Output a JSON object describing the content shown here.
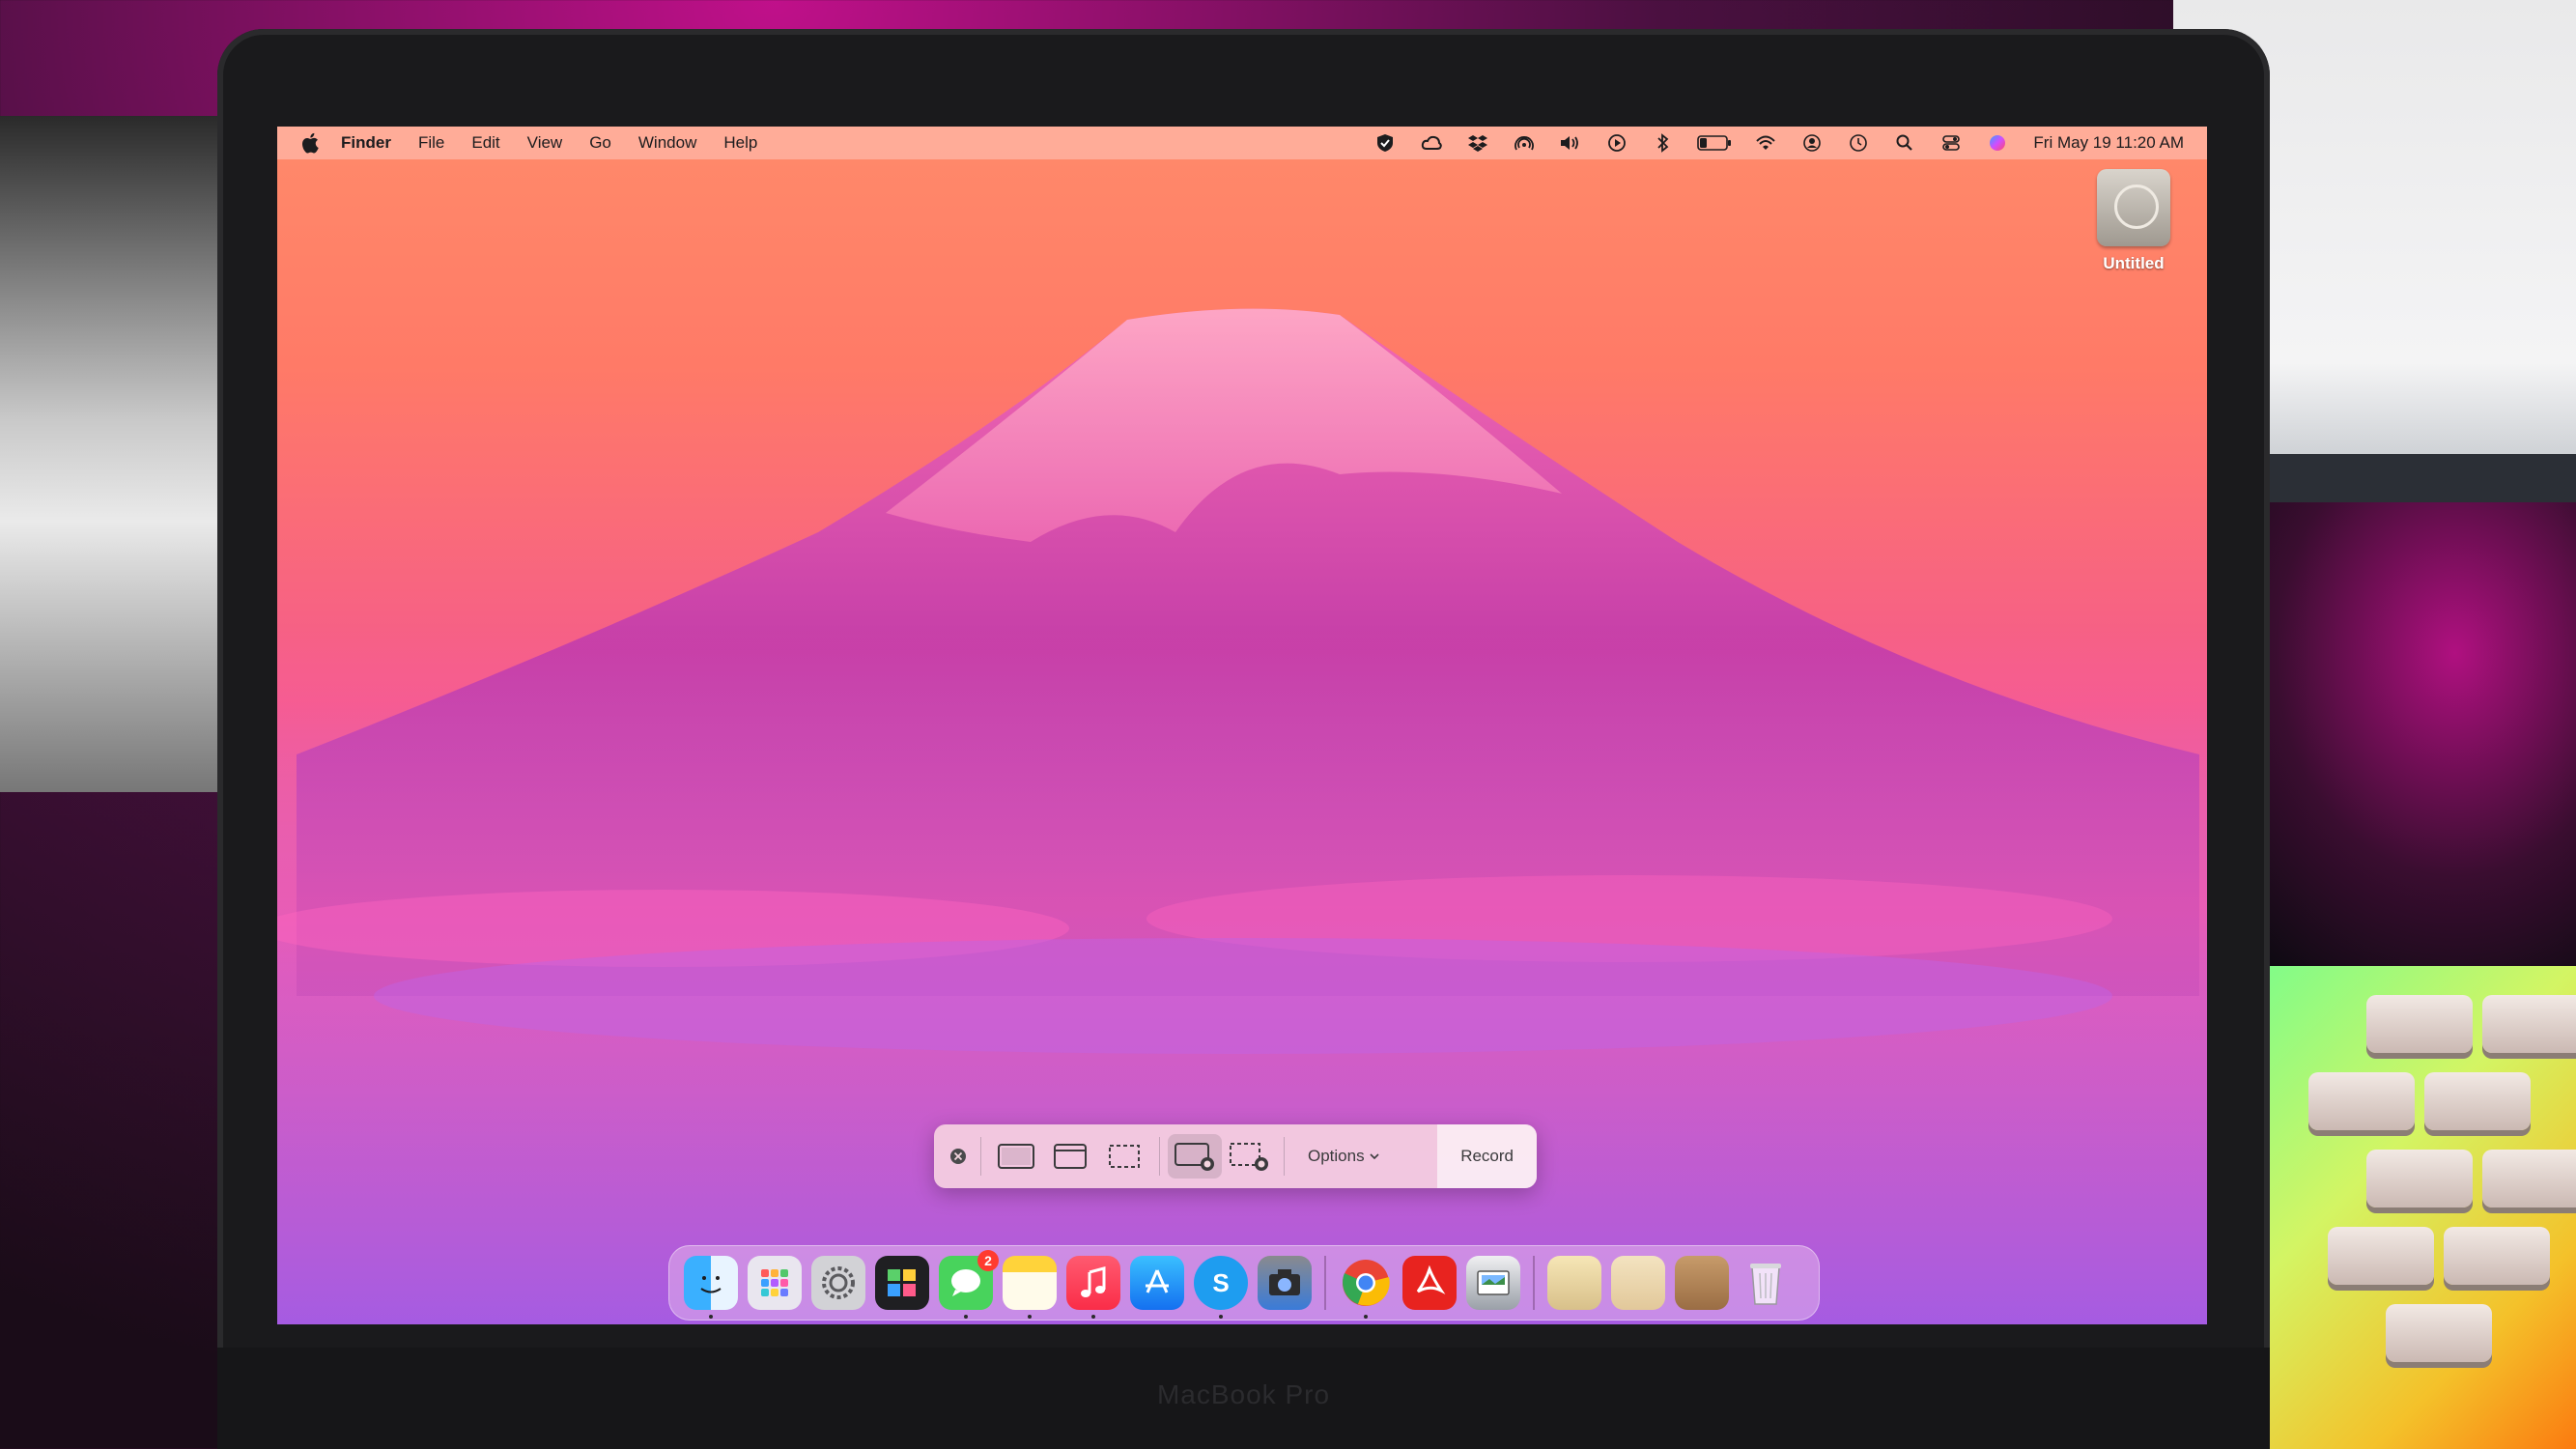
{
  "menubar": {
    "app_name": "Finder",
    "menus": [
      "File",
      "Edit",
      "View",
      "Go",
      "Window",
      "Help"
    ],
    "clock": "Fri May 19  11:20 AM"
  },
  "desktop": {
    "disk_label": "Untitled"
  },
  "screenshot_toolbar": {
    "options_label": "Options",
    "record_label": "Record"
  },
  "dock": {
    "messages_badge": "2",
    "skype_letter": "S"
  },
  "laptop": {
    "brand": "MacBook Pro"
  },
  "colors": {
    "wallpaper_top": "#ff8a6a",
    "wallpaper_bottom": "#8c62e6",
    "mountain": "#c43ea7"
  }
}
